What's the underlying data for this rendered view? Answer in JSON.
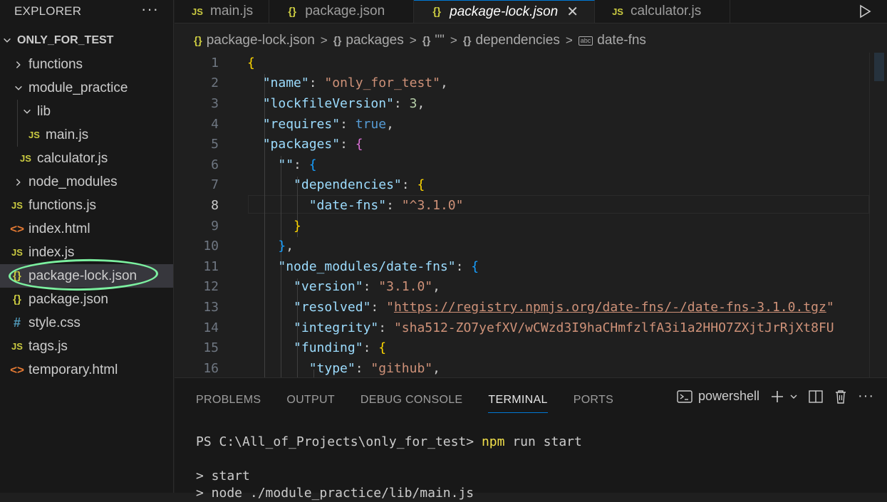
{
  "explorer": {
    "title": "EXPLORER",
    "more": "···",
    "root": "ONLY_FOR_TEST",
    "items": [
      {
        "label": "functions"
      },
      {
        "label": "module_practice"
      },
      {
        "label": "lib"
      },
      {
        "label": "main.js"
      },
      {
        "label": "calculator.js"
      },
      {
        "label": "node_modules"
      },
      {
        "label": "functions.js"
      },
      {
        "label": "index.html"
      },
      {
        "label": "index.js"
      },
      {
        "label": "package-lock.json"
      },
      {
        "label": "package.json"
      },
      {
        "label": "style.css"
      },
      {
        "label": "tags.js"
      },
      {
        "label": "temporary.html"
      }
    ]
  },
  "tabs": [
    {
      "label": "main.js",
      "icon": "JS"
    },
    {
      "label": "package.json",
      "icon": "{}"
    },
    {
      "label": "package-lock.json",
      "icon": "{}",
      "active": true
    },
    {
      "label": "calculator.js",
      "icon": "JS"
    }
  ],
  "breadcrumb": {
    "file": "package-lock.json",
    "packages": "packages",
    "empty_key": "\"\"",
    "dependencies": "dependencies",
    "leaf": "date-fns"
  },
  "editor": {
    "current_line": 8,
    "lines": [
      {
        "n": "1"
      },
      {
        "n": "2"
      },
      {
        "n": "3"
      },
      {
        "n": "4"
      },
      {
        "n": "5"
      },
      {
        "n": "6"
      },
      {
        "n": "7"
      },
      {
        "n": "8"
      },
      {
        "n": "9"
      },
      {
        "n": "10"
      },
      {
        "n": "11"
      },
      {
        "n": "12"
      },
      {
        "n": "13"
      },
      {
        "n": "14"
      },
      {
        "n": "15"
      },
      {
        "n": "16"
      }
    ],
    "tokens": {
      "name_key": "\"name\"",
      "name_val": "\"only_for_test\"",
      "lockfile_key": "\"lockfileVersion\"",
      "lockfile_val": "3",
      "requires_key": "\"requires\"",
      "requires_val": "true",
      "packages_key": "\"packages\"",
      "empty_key": "\"\"",
      "dependencies_key": "\"dependencies\"",
      "datefns_key": "\"date-fns\"",
      "datefns_val": "\"^3.1.0\"",
      "nm_key": "\"node_modules/date-fns\"",
      "version_key": "\"version\"",
      "version_val": "\"3.1.0\"",
      "resolved_key": "\"resolved\"",
      "resolved_val": "https://registry.npmjs.org/date-fns/-/date-fns-3.1.0.tgz",
      "integrity_key": "\"integrity\"",
      "integrity_val": "\"sha512-ZO7yefXV/wCWzd3I9haCHmfzlfA3i1a2HHO7ZXjtJrRjXt8FU",
      "funding_key": "\"funding\"",
      "type_key": "\"type\"",
      "type_val": "\"github\""
    }
  },
  "panel": {
    "tabs": [
      "PROBLEMS",
      "OUTPUT",
      "DEBUG CONSOLE",
      "TERMINAL",
      "PORTS"
    ],
    "active_tab": "TERMINAL",
    "shell": "powershell",
    "terminal": {
      "prompt": "PS C:\\All_of_Projects\\only_for_test> ",
      "cmd_word": "npm",
      "cmd_rest": " run start",
      "out1": "> start",
      "out2": "> node ./module_practice/lib/main.js"
    }
  },
  "colors": {
    "accent": "#0078d4",
    "highlight_ring": "#7cf0a0",
    "json_icon": "#cbcb41",
    "html_icon": "#e37933",
    "css_icon": "#519aba"
  }
}
